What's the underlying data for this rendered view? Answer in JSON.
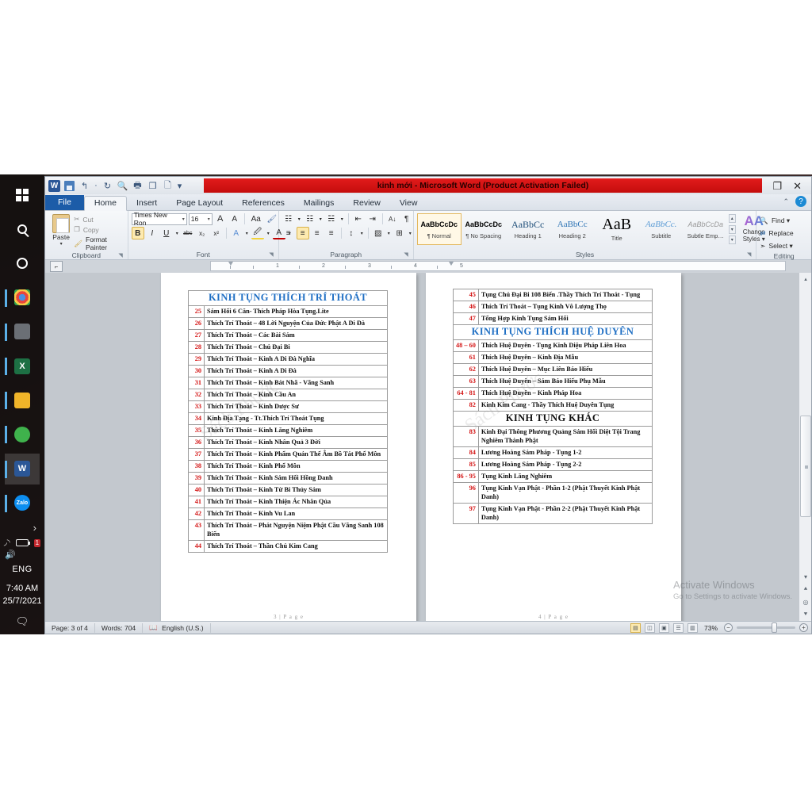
{
  "window": {
    "title": "kinh mới  -  Microsoft Word (Product Activation Failed)",
    "restore_label": "❐",
    "close_label": "✕"
  },
  "quick_access": [
    {
      "name": "word-logo",
      "label": "W"
    },
    {
      "name": "save-icon",
      "label": ""
    },
    {
      "name": "undo-icon",
      "label": "↰"
    },
    {
      "name": "undo-dropdown-icon",
      "label": "▾"
    },
    {
      "name": "redo-icon",
      "label": "↻"
    },
    {
      "name": "print-preview-icon",
      "label": "🔍"
    },
    {
      "name": "quick-print-icon",
      "label": "🖶"
    },
    {
      "name": "open-icon",
      "label": "❐"
    },
    {
      "name": "new-icon",
      "label": "🗋"
    },
    {
      "name": "customize-qat-icon",
      "label": "▾"
    }
  ],
  "tabs": [
    {
      "label": "File",
      "state": "file"
    },
    {
      "label": "Home",
      "state": "selected"
    },
    {
      "label": "Insert",
      "state": "normal"
    },
    {
      "label": "Page Layout",
      "state": "normal"
    },
    {
      "label": "References",
      "state": "normal"
    },
    {
      "label": "Mailings",
      "state": "normal"
    },
    {
      "label": "Review",
      "state": "normal"
    },
    {
      "label": "View",
      "state": "normal"
    }
  ],
  "ribbon": {
    "clipboard": {
      "group_label": "Clipboard",
      "paste_label": "Paste",
      "paste_caret": "▾",
      "cut_label": "Cut",
      "copy_label": "Copy",
      "format_painter_label": "Format Painter"
    },
    "font": {
      "group_label": "Font",
      "font_name": "Times New Ron",
      "font_size": "16",
      "grow_label": "A",
      "shrink_label": "A",
      "change_case_label": "Aa",
      "clear_formatting_label": "",
      "bold_label": "B",
      "italic_label": "I",
      "underline_label": "U",
      "strikethrough_label": "abc",
      "subscript_label": "x₂",
      "superscript_label": "x²",
      "text_effects_label": "A",
      "highlight_label": "ab",
      "font_color_label": "A"
    },
    "paragraph": {
      "group_label": "Paragraph",
      "bullets_label": "☰",
      "numbering_label": "☰",
      "multilevel_label": "☰",
      "decrease_indent_label": "⇤",
      "increase_indent_label": "⇥",
      "sort_label": "A↓",
      "show_marks_label": "¶",
      "align_left_label": "≡",
      "align_center_label": "≡",
      "align_right_label": "≡",
      "justify_label": "≡",
      "line_spacing_label": "↕",
      "shading_label": "▨",
      "borders_label": "⊞"
    },
    "styles": {
      "group_label": "Styles",
      "gallery": [
        {
          "preview": "AaBbCcDc",
          "name": "¶ Normal",
          "selected": true
        },
        {
          "preview": "AaBbCcDc",
          "name": "¶ No Spacing",
          "selected": false
        },
        {
          "preview": "AaBbCc",
          "name": "Heading 1",
          "selected": false
        },
        {
          "preview": "AaBbCc",
          "name": "Heading 2",
          "selected": false
        },
        {
          "preview": "AaB",
          "name": "Title",
          "selected": false
        },
        {
          "preview": "AaBbCc.",
          "name": "Subtitle",
          "selected": false
        },
        {
          "preview": "AaBbCcDa",
          "name": "Subtle Emp…",
          "selected": false
        }
      ],
      "change_styles_label": "Change",
      "change_styles_label2": "Styles ▾"
    },
    "editing": {
      "group_label": "Editing",
      "find_label": "Find ▾",
      "replace_label": "Replace",
      "select_label": "Select ▾"
    }
  },
  "ruler": {
    "numbers": [
      "1",
      "2",
      "3",
      "4",
      "5"
    ]
  },
  "document": {
    "page_left": {
      "footer": "3 | P a g e",
      "watermark": "Sách Phước",
      "header_title": "KINH TỤNG THÍCH TRÍ THOÁT",
      "rows": [
        {
          "num": "25",
          "text": "Sám Hối 6 Căn- Thích Pháp Hòa Tụng.Lite"
        },
        {
          "num": "26",
          "text": "Thích Trí Thoát – 48 Lời Nguyện Của Đức Phật A Di Đà"
        },
        {
          "num": "27",
          "text": "Thích Trí Thoát – Các Bài Sám"
        },
        {
          "num": "28",
          "text": "Thích Trí Thoát – Chú Đại Bi"
        },
        {
          "num": "29",
          "text": "Thích Trí Thoát – Kinh A Di Đà Nghĩa"
        },
        {
          "num": "30",
          "text": "Thích Trí Thoát – Kinh A Di Đà"
        },
        {
          "num": "31",
          "text": "Thích Trí Thoát – Kinh Bát Nhã - Vãng Sanh"
        },
        {
          "num": "32",
          "text": "Thích Trí Thoát – Kinh Cầu An"
        },
        {
          "num": "33",
          "text": "Thích Trí Thoát – Kinh Dược Sư"
        },
        {
          "num": "34",
          "text": "Kinh Địa Tạng - Tt.Thích Trí Thoát Tụng"
        },
        {
          "num": "35",
          "text": "Thích Trí Thoát – Kinh Lăng Nghiêm"
        },
        {
          "num": "36",
          "text": "Thích Trí Thoát – Kinh Nhân Quả 3 Đời"
        },
        {
          "num": "37",
          "text": "Thích Trí Thoát – Kinh Phẩm Quán Thế Âm Bồ Tát Phổ Môn"
        },
        {
          "num": "38",
          "text": "Thích Trí Thoát – Kinh Phổ Môn"
        },
        {
          "num": "39",
          "text": "Thích Trí Thoát – Kinh Sám Hối Hồng Danh"
        },
        {
          "num": "40",
          "text": "Thích Trí Thoát – Kinh Từ Bi Thủy Sám"
        },
        {
          "num": "41",
          "text": "Thích Trí Thoát – Kinh Thiện Ác Nhân Qủa"
        },
        {
          "num": "42",
          "text": "Thích Trí Thoát – Kinh Vu Lan"
        },
        {
          "num": "43",
          "text": "Thích Trí Thoát – Phát Nguyện Niệm Phật Cầu Vãng Sanh 108 Biến"
        },
        {
          "num": "44",
          "text": "Thích Trí Thoát – Thần Chú Kim Cang"
        }
      ]
    },
    "page_right": {
      "footer": "4 | P a g e",
      "watermark": "Sách Phước",
      "rows_top": [
        {
          "num": "45",
          "text": "Tụng Chú Đại Bi 108 Biến .Thầy Thích Trí Thoát - Tụng"
        },
        {
          "num": "46",
          "text": "Thích Trí Thoát – Tụng Kinh Vô Lượng Thọ"
        },
        {
          "num": "47",
          "text": "Tổng Hợp Kinh Tụng Sám Hối"
        }
      ],
      "header_title_2": "KINH TỤNG THÍCH HUỆ DUYÊN",
      "rows_mid": [
        {
          "num": "48 – 60",
          "text": "Thích Huệ Duyên - Tụng Kinh Diệu Pháp Liên Hoa"
        },
        {
          "num": "61",
          "text": "Thích Huệ Duyên – Kinh Địa Mẫu"
        },
        {
          "num": "62",
          "text": "Thích Huệ Duyên – Mục Liên Báo Hiếu"
        },
        {
          "num": "63",
          "text": "Thích Huệ Duyên – Sám Báo Hiếu Phụ Mẫu"
        },
        {
          "num": "64 - 81",
          "text": "Thích Huệ Duyên – Kinh Pháp Hoa"
        },
        {
          "num": "82",
          "text": "Kinh Kim Cang - Thầy Thích Huệ Duyên Tụng"
        }
      ],
      "header_title_3": "KINH TỤNG KHÁC",
      "rows_bottom": [
        {
          "num": "83",
          "text": "Kinh Đại Thông Phương Quảng Sám Hối Diệt Tội Trang Nghiêm Thành Phật"
        },
        {
          "num": "84",
          "text": "Lương Hoàng Sám Pháp - Tụng 1-2"
        },
        {
          "num": "85",
          "text": "Lương Hoàng Sám Pháp - Tụng 2-2"
        },
        {
          "num": "86 - 95",
          "text": "Tụng Kinh Lăng Nghiêm"
        },
        {
          "num": "96",
          "text": "Tụng Kinh Vạn Phật - Phần 1-2 (Phật Thuyết Kinh Phật Danh)"
        },
        {
          "num": "97",
          "text": "Tụng Kinh Vạn Phật - Phần 2-2 (Phật Thuyết Kinh Phật Danh)"
        }
      ]
    }
  },
  "watermark_overlay": {
    "line1": "Activate Windows",
    "line2": "Go to Settings to activate Windows."
  },
  "status_bar": {
    "page": "Page: 3 of 4",
    "words": "Words: 704",
    "language": "English (U.S.)",
    "zoom": "73%",
    "zoom_out": "−",
    "zoom_in": "+",
    "views": [
      {
        "name": "print-layout-view",
        "glyph": "▤",
        "active": true
      },
      {
        "name": "full-screen-reading-view",
        "glyph": "◫",
        "active": false
      },
      {
        "name": "web-layout-view",
        "glyph": "▣",
        "active": false
      },
      {
        "name": "outline-view",
        "glyph": "☰",
        "active": false
      },
      {
        "name": "draft-view",
        "glyph": "▥",
        "active": false
      }
    ]
  },
  "taskbar": {
    "items": [
      {
        "name": "start-button",
        "kind": "win",
        "label": ""
      },
      {
        "name": "search-icon",
        "kind": "mag",
        "label": ""
      },
      {
        "name": "cortana-icon",
        "kind": "circ",
        "label": ""
      },
      {
        "name": "chrome-icon",
        "kind": "sq",
        "label": "",
        "color": "#e8453c",
        "running": true
      },
      {
        "name": "coccoc-icon",
        "kind": "sq",
        "label": "",
        "color": "#5a5f66",
        "running": true
      },
      {
        "name": "excel-icon",
        "kind": "sq",
        "label": "X",
        "color": "#1d7044",
        "running": true
      },
      {
        "name": "file-explorer-icon",
        "kind": "sq",
        "label": "",
        "color": "#f0b429",
        "running": true
      },
      {
        "name": "unikey-icon",
        "kind": "sq",
        "label": "",
        "color": "#3fb24c",
        "running": true
      },
      {
        "name": "word-icon",
        "kind": "sq",
        "label": "W",
        "color": "#2b5797",
        "running": true,
        "active": true
      },
      {
        "name": "zalo-icon",
        "kind": "sq",
        "label": "Zalo",
        "color": "#0d8ef0",
        "running": true
      }
    ],
    "tray": {
      "chevron": "›",
      "wifi": "◤",
      "battery": "",
      "notification_badge": "1",
      "volume": "🕩",
      "language": "ENG",
      "time": "7:40 AM",
      "date": "25/7/2021",
      "action_center": "🗩"
    }
  }
}
